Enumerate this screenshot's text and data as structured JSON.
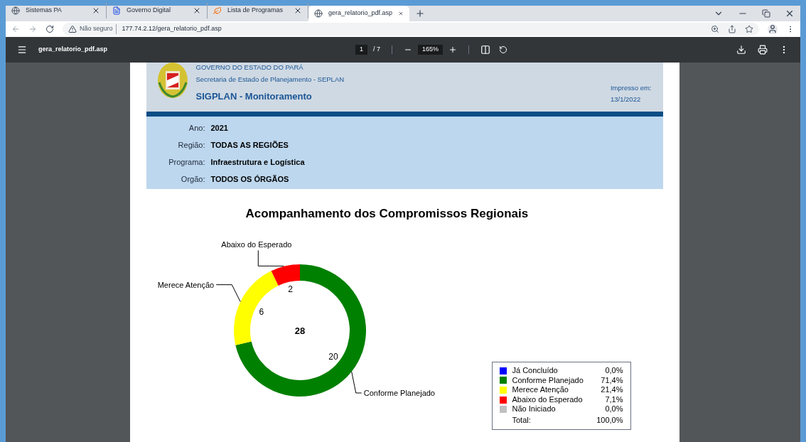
{
  "tabs": [
    {
      "label": "Sistemas PA",
      "selected": false,
      "kind": "globe"
    },
    {
      "label": "Governo Digital",
      "selected": false,
      "kind": "doc"
    },
    {
      "label": "Lista de Programas",
      "selected": false,
      "kind": "leaf"
    },
    {
      "label": "gera_relatorio_pdf.asp",
      "selected": true,
      "kind": "globe"
    }
  ],
  "address": {
    "security": "Não seguro",
    "url": "177.74.2.12/gera_relatorio_pdf.asp"
  },
  "pdf_toolbar": {
    "filename": "gera_relatorio_pdf.asp",
    "page": "1",
    "page_total": "/ 7",
    "zoom": "165%"
  },
  "report": {
    "org_lines": [
      "GOVERNO DO ESTADO DO PARÁ",
      "Secretaria de Estado de Planejamento - SEPLAN"
    ],
    "system": "SIGPLAN - Monitoramento",
    "printed_label": "Impresso em:",
    "printed_date": "13/1/2022",
    "filters": [
      {
        "label": "Ano:",
        "value": "2021"
      },
      {
        "label": "Região:",
        "value": "TODAS AS REGIÕES"
      },
      {
        "label": "Programa:",
        "value": "Infraestrutura e Logística"
      },
      {
        "label": "Orgão:",
        "value": "TODOS OS ÓRGÃOS"
      }
    ],
    "chart_data": {
      "type": "donut",
      "title": "Acompanhamento dos Compromissos Regionais",
      "categories": [
        "Conforme Planejado",
        "Merece Atenção",
        "Abaixo do Esperado"
      ],
      "values": [
        20,
        6,
        2
      ],
      "colors": [
        "#008000",
        "#ffff00",
        "#ff0000"
      ],
      "data_labels": true,
      "annotations": [
        {
          "text": "28"
        }
      ]
    },
    "legend": [
      {
        "label": "Já Concluído",
        "percent": "0,0%",
        "color": "#0000ff"
      },
      {
        "label": "Conforme Planejado",
        "percent": "71,4%",
        "color": "#008000"
      },
      {
        "label": "Merece Atenção",
        "percent": "21,4%",
        "color": "#ffff00"
      },
      {
        "label": "Abaixo do Esperado",
        "percent": "7,1%",
        "color": "#ff0000"
      },
      {
        "label": "Não Iniciado",
        "percent": "0,0%",
        "color": "#c0c0c0"
      }
    ],
    "total": {
      "label": "Total:",
      "percent": "100,0%"
    }
  }
}
